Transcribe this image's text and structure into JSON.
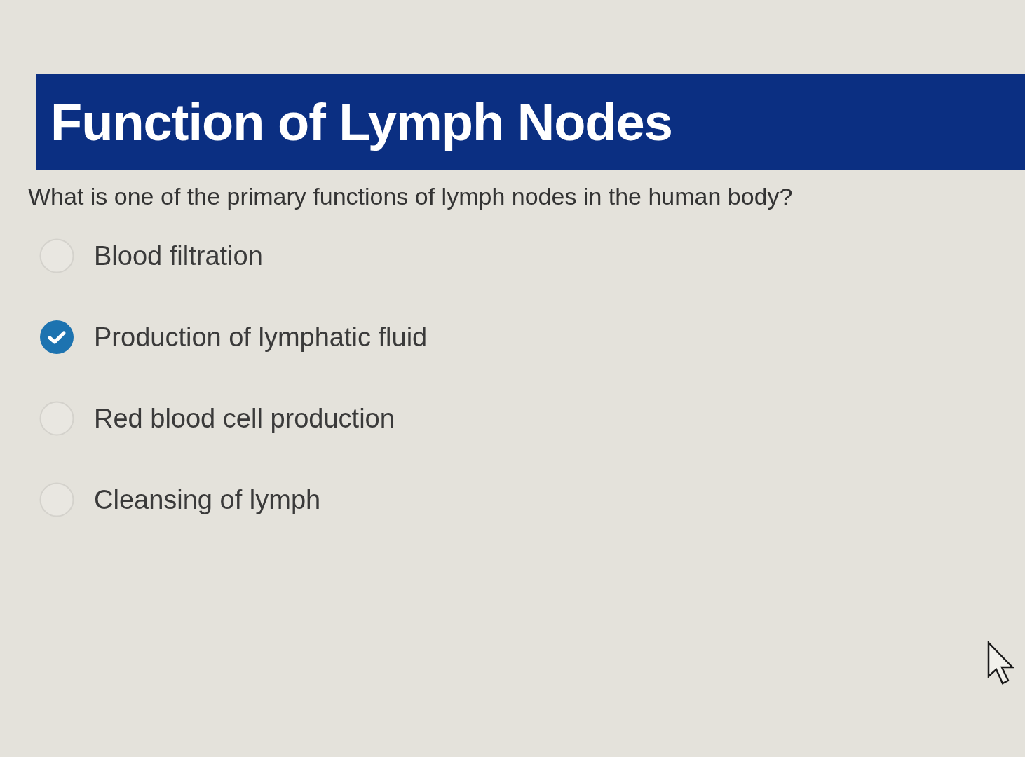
{
  "title": "Function of Lymph Nodes",
  "question": "What is one of the primary functions of lymph nodes in the human body?",
  "options": [
    {
      "label": "Blood filtration",
      "selected": false
    },
    {
      "label": "Production of lymphatic fluid",
      "selected": true
    },
    {
      "label": "Red blood cell production",
      "selected": false
    },
    {
      "label": "Cleansing of lymph",
      "selected": false
    }
  ]
}
